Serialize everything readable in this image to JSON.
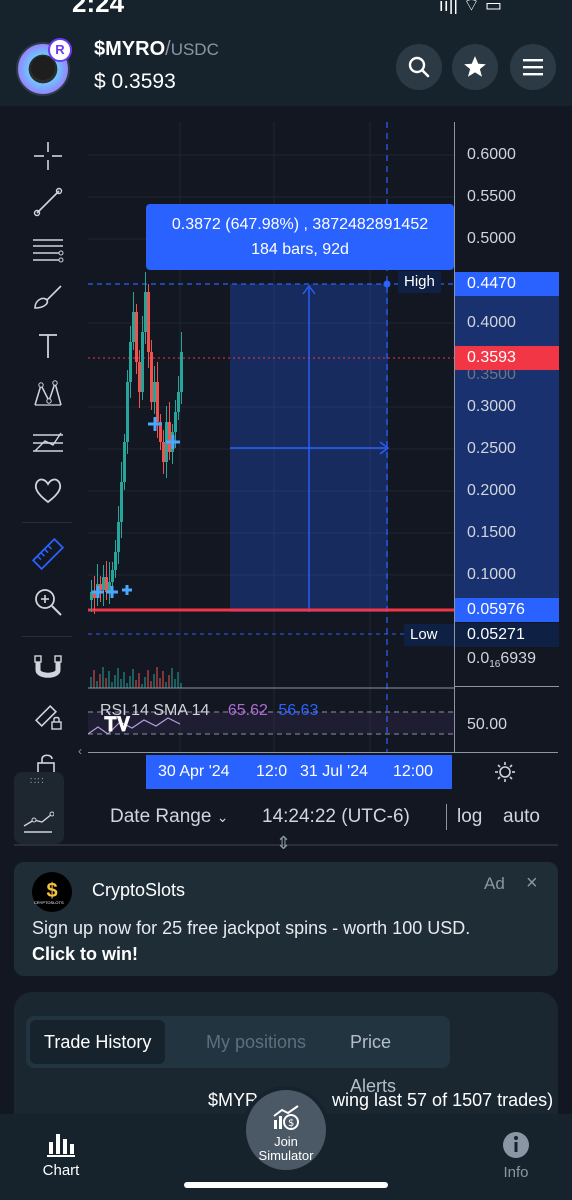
{
  "status": {
    "time": "2:24",
    "signal": "ıı|| ⌔ ▭"
  },
  "header": {
    "symbol": "$MYRO",
    "separator": "/",
    "quote": "USDC",
    "price": "$ 0.3593",
    "avatar_badge": "R"
  },
  "icons": {
    "search": "search-icon",
    "star": "star-icon",
    "menu": "menu-icon"
  },
  "yaxis": {
    "ticks": [
      "0.6000",
      "0.5500",
      "0.5000",
      "0.4000",
      "0.3000",
      "0.2500",
      "0.2000",
      "0.1500",
      "0.1000",
      "50.00"
    ],
    "hidden_tick": "0.3500",
    "tiny_price": {
      "main": "0.0",
      "sub": "16",
      "rest": "6939"
    },
    "high_label": "High",
    "high_value": "0.4470",
    "current_value": "0.3593",
    "selection_low_value": "0.05976",
    "low_label": "Low",
    "low_value": "0.05271"
  },
  "measure_tooltip": {
    "line1": "0.3872 (647.98%) , 3872482891452",
    "line2": "184 bars, 92d"
  },
  "rsi": {
    "label": "RSI 14 SMA 14",
    "value1": "65.62",
    "value2": "56.63"
  },
  "xaxis": {
    "label1": "30 Apr '24",
    "label2": "12:0",
    "label3": "31 Jul '24",
    "label4": "12:00"
  },
  "bottom_bar": {
    "date_range": "Date Range",
    "time": "14:24:22 (UTC-6)",
    "log": "log",
    "auto": "auto"
  },
  "ad": {
    "title": "CryptoSlots",
    "ad_label": "Ad",
    "text": "Sign up now for 25 free jackpot spins - worth 100 USD.",
    "cta": "Click to win!",
    "logo_letter": "$",
    "logo_caption": "CRYPTOSLOTS"
  },
  "tabs": [
    {
      "label": "Trade History",
      "active": true
    },
    {
      "label": "My positions",
      "active": false
    },
    {
      "label": "Price Alerts",
      "active": false
    }
  ],
  "trades": {
    "text_left": "$MYRO",
    "text_right": "wing last 57 of 1507 trades)"
  },
  "nav": {
    "chart": "Chart",
    "simulator_line1": "Join",
    "simulator_line2": "Simulator",
    "info": "Info"
  },
  "colors": {
    "accent": "#2962ff",
    "price_line": "#f23645",
    "background": "#131722",
    "header": "#17232c"
  }
}
